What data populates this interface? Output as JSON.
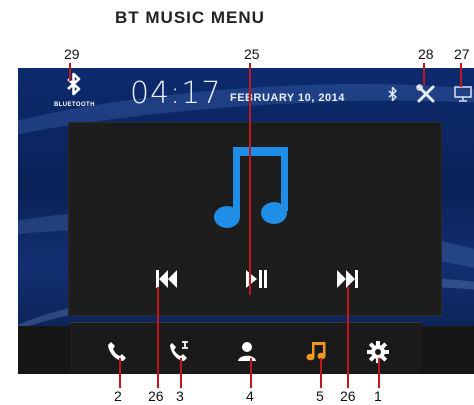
{
  "heading": "BT MUSIC MENU",
  "callouts": {
    "c29": "29",
    "c25": "25",
    "c28": "28",
    "c27": "27",
    "b2": "2",
    "b26a": "26",
    "b3": "3",
    "b4": "4",
    "b5": "5",
    "b26b": "26",
    "b1": "1"
  },
  "status": {
    "bluetooth_label": "BLUETOOTH",
    "bluetooth_icon": "bluetooth-icon",
    "time": "04:17",
    "date": "FEBRUARY 10, 2014",
    "small_bt_icon": "bluetooth-status-icon",
    "settings_icon": "wrench-screwdriver-icon",
    "display_icon": "monitor-icon"
  },
  "player": {
    "art_icon": "music-note-icon",
    "prev_icon": "skip-previous-icon",
    "play_icon": "play-pause-icon",
    "next_icon": "skip-next-icon"
  },
  "dock": {
    "phone_icon": "phone-icon",
    "call_log_icon": "call-log-icon",
    "contacts_icon": "contact-icon",
    "music_icon": "music-note-icon",
    "settings_icon": "gear-icon"
  },
  "colors": {
    "accent": "#1e8ee6",
    "music_active": "#f39a1d",
    "callout_line": "#c0161d",
    "background": "#0c2a6e"
  }
}
